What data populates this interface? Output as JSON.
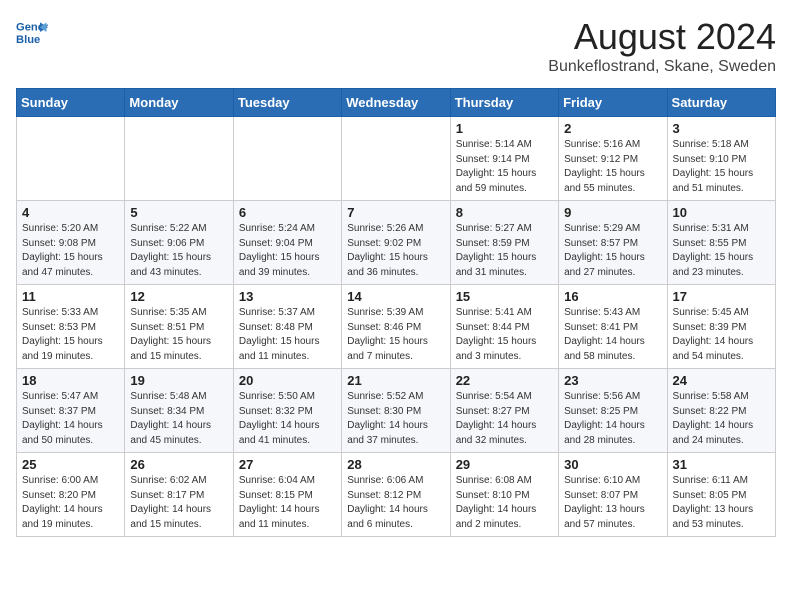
{
  "header": {
    "logo_line1": "General",
    "logo_line2": "Blue",
    "main_title": "August 2024",
    "subtitle": "Bunkeflostrand, Skane, Sweden"
  },
  "weekdays": [
    "Sunday",
    "Monday",
    "Tuesday",
    "Wednesday",
    "Thursday",
    "Friday",
    "Saturday"
  ],
  "weeks": [
    [
      {
        "day": "",
        "info": ""
      },
      {
        "day": "",
        "info": ""
      },
      {
        "day": "",
        "info": ""
      },
      {
        "day": "",
        "info": ""
      },
      {
        "day": "1",
        "info": "Sunrise: 5:14 AM\nSunset: 9:14 PM\nDaylight: 15 hours\nand 59 minutes."
      },
      {
        "day": "2",
        "info": "Sunrise: 5:16 AM\nSunset: 9:12 PM\nDaylight: 15 hours\nand 55 minutes."
      },
      {
        "day": "3",
        "info": "Sunrise: 5:18 AM\nSunset: 9:10 PM\nDaylight: 15 hours\nand 51 minutes."
      }
    ],
    [
      {
        "day": "4",
        "info": "Sunrise: 5:20 AM\nSunset: 9:08 PM\nDaylight: 15 hours\nand 47 minutes."
      },
      {
        "day": "5",
        "info": "Sunrise: 5:22 AM\nSunset: 9:06 PM\nDaylight: 15 hours\nand 43 minutes."
      },
      {
        "day": "6",
        "info": "Sunrise: 5:24 AM\nSunset: 9:04 PM\nDaylight: 15 hours\nand 39 minutes."
      },
      {
        "day": "7",
        "info": "Sunrise: 5:26 AM\nSunset: 9:02 PM\nDaylight: 15 hours\nand 36 minutes."
      },
      {
        "day": "8",
        "info": "Sunrise: 5:27 AM\nSunset: 8:59 PM\nDaylight: 15 hours\nand 31 minutes."
      },
      {
        "day": "9",
        "info": "Sunrise: 5:29 AM\nSunset: 8:57 PM\nDaylight: 15 hours\nand 27 minutes."
      },
      {
        "day": "10",
        "info": "Sunrise: 5:31 AM\nSunset: 8:55 PM\nDaylight: 15 hours\nand 23 minutes."
      }
    ],
    [
      {
        "day": "11",
        "info": "Sunrise: 5:33 AM\nSunset: 8:53 PM\nDaylight: 15 hours\nand 19 minutes."
      },
      {
        "day": "12",
        "info": "Sunrise: 5:35 AM\nSunset: 8:51 PM\nDaylight: 15 hours\nand 15 minutes."
      },
      {
        "day": "13",
        "info": "Sunrise: 5:37 AM\nSunset: 8:48 PM\nDaylight: 15 hours\nand 11 minutes."
      },
      {
        "day": "14",
        "info": "Sunrise: 5:39 AM\nSunset: 8:46 PM\nDaylight: 15 hours\nand 7 minutes."
      },
      {
        "day": "15",
        "info": "Sunrise: 5:41 AM\nSunset: 8:44 PM\nDaylight: 15 hours\nand 3 minutes."
      },
      {
        "day": "16",
        "info": "Sunrise: 5:43 AM\nSunset: 8:41 PM\nDaylight: 14 hours\nand 58 minutes."
      },
      {
        "day": "17",
        "info": "Sunrise: 5:45 AM\nSunset: 8:39 PM\nDaylight: 14 hours\nand 54 minutes."
      }
    ],
    [
      {
        "day": "18",
        "info": "Sunrise: 5:47 AM\nSunset: 8:37 PM\nDaylight: 14 hours\nand 50 minutes."
      },
      {
        "day": "19",
        "info": "Sunrise: 5:48 AM\nSunset: 8:34 PM\nDaylight: 14 hours\nand 45 minutes."
      },
      {
        "day": "20",
        "info": "Sunrise: 5:50 AM\nSunset: 8:32 PM\nDaylight: 14 hours\nand 41 minutes."
      },
      {
        "day": "21",
        "info": "Sunrise: 5:52 AM\nSunset: 8:30 PM\nDaylight: 14 hours\nand 37 minutes."
      },
      {
        "day": "22",
        "info": "Sunrise: 5:54 AM\nSunset: 8:27 PM\nDaylight: 14 hours\nand 32 minutes."
      },
      {
        "day": "23",
        "info": "Sunrise: 5:56 AM\nSunset: 8:25 PM\nDaylight: 14 hours\nand 28 minutes."
      },
      {
        "day": "24",
        "info": "Sunrise: 5:58 AM\nSunset: 8:22 PM\nDaylight: 14 hours\nand 24 minutes."
      }
    ],
    [
      {
        "day": "25",
        "info": "Sunrise: 6:00 AM\nSunset: 8:20 PM\nDaylight: 14 hours\nand 19 minutes."
      },
      {
        "day": "26",
        "info": "Sunrise: 6:02 AM\nSunset: 8:17 PM\nDaylight: 14 hours\nand 15 minutes."
      },
      {
        "day": "27",
        "info": "Sunrise: 6:04 AM\nSunset: 8:15 PM\nDaylight: 14 hours\nand 11 minutes."
      },
      {
        "day": "28",
        "info": "Sunrise: 6:06 AM\nSunset: 8:12 PM\nDaylight: 14 hours\nand 6 minutes."
      },
      {
        "day": "29",
        "info": "Sunrise: 6:08 AM\nSunset: 8:10 PM\nDaylight: 14 hours\nand 2 minutes."
      },
      {
        "day": "30",
        "info": "Sunrise: 6:10 AM\nSunset: 8:07 PM\nDaylight: 13 hours\nand 57 minutes."
      },
      {
        "day": "31",
        "info": "Sunrise: 6:11 AM\nSunset: 8:05 PM\nDaylight: 13 hours\nand 53 minutes."
      }
    ]
  ]
}
